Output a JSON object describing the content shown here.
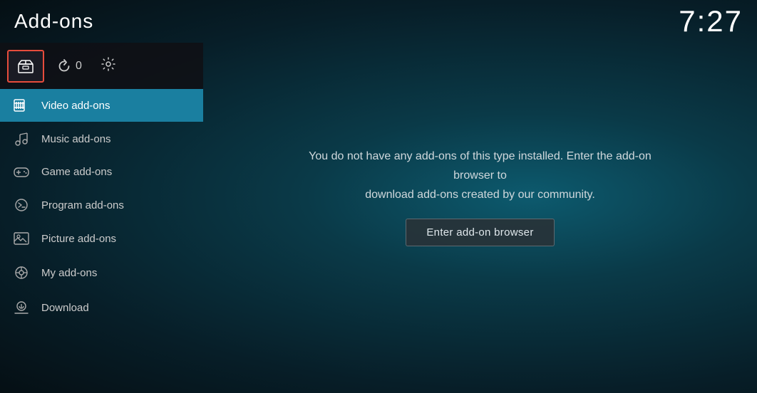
{
  "header": {
    "title": "Add-ons",
    "time": "7:27"
  },
  "toolbar": {
    "addon_box_label": "add-on box",
    "refresh_count": "0",
    "settings_label": "settings"
  },
  "nav": {
    "items": [
      {
        "id": "video-addons",
        "label": "Video add-ons",
        "icon": "video",
        "active": true
      },
      {
        "id": "music-addons",
        "label": "Music add-ons",
        "icon": "music",
        "active": false
      },
      {
        "id": "game-addons",
        "label": "Game add-ons",
        "icon": "game",
        "active": false
      },
      {
        "id": "program-addons",
        "label": "Program add-ons",
        "icon": "program",
        "active": false
      },
      {
        "id": "picture-addons",
        "label": "Picture add-ons",
        "icon": "picture",
        "active": false
      },
      {
        "id": "my-addons",
        "label": "My add-ons",
        "icon": "myaddon",
        "active": false
      },
      {
        "id": "download",
        "label": "Download",
        "icon": "download",
        "active": false
      }
    ]
  },
  "main": {
    "empty_message_line1": "You do not have any add-ons of this type installed. Enter the add-on browser to",
    "empty_message_line2": "download add-ons created by our community.",
    "browser_button_label": "Enter add-on browser"
  }
}
